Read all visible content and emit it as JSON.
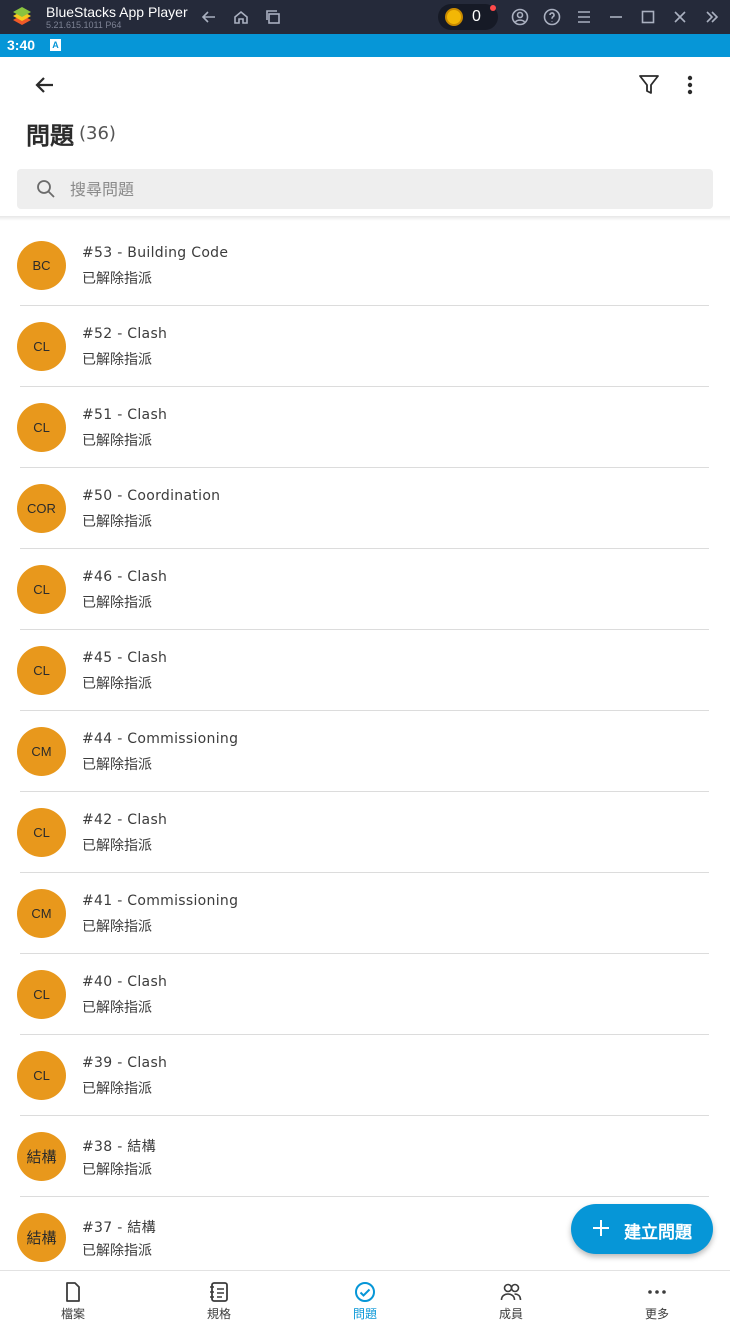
{
  "emulator": {
    "title": "BlueStacks App Player",
    "version": "5.21.615.1011  P64",
    "coin_count": "0"
  },
  "status_bar": {
    "time": "3:40",
    "badge": "A"
  },
  "header": {
    "title": "問題",
    "count": "(36)"
  },
  "search": {
    "placeholder": "搜尋問題",
    "value": ""
  },
  "issues": [
    {
      "initials": "BC",
      "title": "#53 - Building Code",
      "status": "已解除指派"
    },
    {
      "initials": "CL",
      "title": "#52 - Clash",
      "status": "已解除指派"
    },
    {
      "initials": "CL",
      "title": "#51 - Clash",
      "status": "已解除指派"
    },
    {
      "initials": "COR",
      "title": "#50 - Coordination",
      "status": "已解除指派"
    },
    {
      "initials": "CL",
      "title": "#46 - Clash",
      "status": "已解除指派"
    },
    {
      "initials": "CL",
      "title": "#45 - Clash",
      "status": "已解除指派"
    },
    {
      "initials": "CM",
      "title": "#44 - Commissioning",
      "status": "已解除指派"
    },
    {
      "initials": "CL",
      "title": "#42 - Clash",
      "status": "已解除指派"
    },
    {
      "initials": "CM",
      "title": "#41 - Commissioning",
      "status": "已解除指派"
    },
    {
      "initials": "CL",
      "title": "#40 - Clash",
      "status": "已解除指派"
    },
    {
      "initials": "CL",
      "title": "#39 - Clash",
      "status": "已解除指派"
    },
    {
      "initials": "結構",
      "title": "#38 - 結構",
      "status": "已解除指派"
    },
    {
      "initials": "結構",
      "title": "#37 - 結構",
      "status": "已解除指派"
    }
  ],
  "fab": {
    "label": "建立問題"
  },
  "bottom_nav": [
    {
      "label": "檔案",
      "icon": "document-icon"
    },
    {
      "label": "規格",
      "icon": "spec-book-icon"
    },
    {
      "label": "問題",
      "icon": "issue-check-icon",
      "active": true
    },
    {
      "label": "成員",
      "icon": "members-icon"
    },
    {
      "label": "更多",
      "icon": "more-dots-icon"
    }
  ],
  "colors": {
    "accent": "#0696d7",
    "avatar": "#e8981c",
    "emulator_bar": "#252a3a"
  }
}
